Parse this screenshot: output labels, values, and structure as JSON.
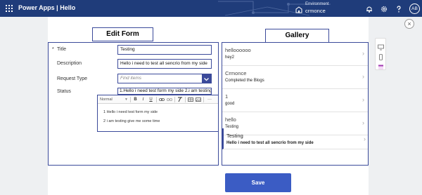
{
  "header": {
    "app_title": "Power Apps | Hello",
    "environment_label": "Environment",
    "environment_name": "crmonce",
    "avatar_initials": "AB",
    "bar_color": "#1f3c7a"
  },
  "edit_form": {
    "heading": "Edit Form",
    "fields": {
      "title": {
        "label": "Title",
        "value": "Testing"
      },
      "description": {
        "label": "Description",
        "value": "Hello i need to test all sencrio from my side"
      },
      "request_type": {
        "label": "Request Type",
        "placeholder": "Find items"
      },
      "status": {
        "label": "Status",
        "value": "1.Hello i need test form my side 2.i am testing give me some time"
      }
    },
    "rich_text": {
      "style": "Normal",
      "toolbar": {
        "bold": "B",
        "italic": "I",
        "underline": "U",
        "more": "···"
      },
      "lines": [
        "1 Hello i need test form my side",
        "2 i am testing give me some time"
      ]
    }
  },
  "gallery": {
    "heading": "Gallery",
    "items": [
      {
        "title": "helloooooo",
        "subtitle": "hey2"
      },
      {
        "title": "Crmonce",
        "subtitle": "Completed the Blogs"
      },
      {
        "title": "1",
        "subtitle": "good"
      },
      {
        "title": "hello",
        "subtitle": "Testing"
      },
      {
        "title": "Testing",
        "subtitle": "Hello i need to test all sencrio from my side"
      }
    ]
  },
  "actions": {
    "save_label": "Save",
    "close_glyph": "×"
  },
  "colors": {
    "accent": "#3b4a9a",
    "button": "#3b5cc4",
    "header": "#1f3c7a"
  }
}
